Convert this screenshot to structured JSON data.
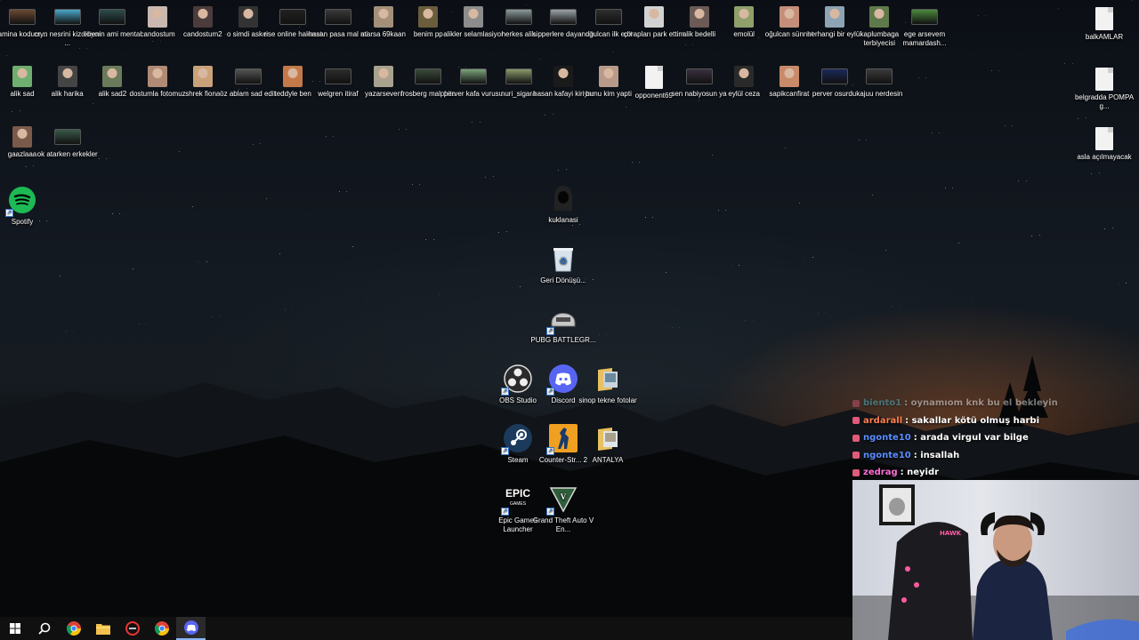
{
  "desktop": {
    "icons_row1": [
      {
        "label": "amina kodum...",
        "icon": "video-thumbnail",
        "color": "#6b4a32"
      },
      {
        "label": "cryn nesrini kizdiriyor ...",
        "icon": "video-thumbnail",
        "color": "#4aa7c9"
      },
      {
        "label": "ebenin ami mental",
        "icon": "video-thumbnail",
        "color": "#2f4c4c"
      },
      {
        "label": "candostum",
        "icon": "photo-thumbnail",
        "color": "#c9b7b0"
      },
      {
        "label": "candostum2",
        "icon": "photo-thumbnail",
        "color": "#4c3b3b"
      },
      {
        "label": "o simdi asker",
        "icon": "photo-thumbnail",
        "color": "#333333"
      },
      {
        "label": "rise online hakaret",
        "icon": "video-thumbnail",
        "color": "#222222"
      },
      {
        "label": "hasan pasa mal mi",
        "icon": "video-thumbnail",
        "color": "#3a3a3a"
      },
      {
        "label": "atarsa 69kaan",
        "icon": "photo-thumbnail",
        "color": "#a38f7a"
      },
      {
        "label": "benim pp",
        "icon": "photo-thumbnail",
        "color": "#6b5d3c"
      },
      {
        "label": "alikler selamlasiyor",
        "icon": "photo-thumbnail",
        "color": "#8c8c8c"
      },
      {
        "label": "herkes alik",
        "icon": "video-thumbnail",
        "color": "#8a9a9a"
      },
      {
        "label": "sipperlere dayandik",
        "icon": "video-thumbnail",
        "color": "#9aa3a8"
      },
      {
        "label": "ogulcan ilk edit",
        "icon": "video-thumbnail",
        "color": "#2e2e2e"
      },
      {
        "label": "çorapları park ettim",
        "icon": "photo-thumbnail",
        "color": "#d2d2d2"
      },
      {
        "label": "alik bedelli",
        "icon": "photo-thumbnail",
        "color": "#6b5a55"
      },
      {
        "label": "emolül",
        "icon": "photo-thumbnail",
        "color": "#8fa06b"
      },
      {
        "label": "oğulcan sünnet",
        "icon": "photo-thumbnail",
        "color": "#c48e7a"
      },
      {
        "label": "herhangi bir eylül",
        "icon": "photo-thumbnail",
        "color": "#8ea3b3"
      },
      {
        "label": "kaplumbaga terbiyecisi",
        "icon": "photo-thumbnail",
        "color": "#5f7a4a"
      },
      {
        "label": "ege arsevem mamardash...",
        "icon": "video-thumbnail",
        "color": "#4d8a3e"
      }
    ],
    "icons_row2": [
      {
        "label": "alik sad",
        "icon": "photo-thumbnail",
        "color": "#6fae6f"
      },
      {
        "label": "alik harika",
        "icon": "photo-thumbnail",
        "color": "#444444"
      },
      {
        "label": "alik sad2",
        "icon": "photo-thumbnail",
        "color": "#6b7a5a"
      },
      {
        "label": "dostumla fotomuz",
        "icon": "photo-thumbnail",
        "color": "#b08a74"
      },
      {
        "label": "shrek fiona",
        "icon": "photo-thumbnail",
        "color": "#c9a27a"
      },
      {
        "label": "öz ablam sad edit",
        "icon": "video-thumbnail",
        "color": "#555555"
      },
      {
        "label": "teddyle ben",
        "icon": "photo-thumbnail",
        "color": "#c47a48"
      },
      {
        "label": "welgren itiraf",
        "icon": "video-thumbnail",
        "color": "#2d2d2d"
      },
      {
        "label": "yazarseven",
        "icon": "photo-thumbnail",
        "color": "#a8a28e"
      },
      {
        "label": "frosberg malphite",
        "icon": "video-thumbnail",
        "color": "#3a4a3a"
      },
      {
        "label": "perver kafa vurusu",
        "icon": "video-thumbnail",
        "color": "#7aa37a"
      },
      {
        "label": "nuri_sigara",
        "icon": "video-thumbnail",
        "color": "#8a9a6a"
      },
      {
        "label": "hasan kafayi kiriyor",
        "icon": "photo-thumbnail",
        "color": "#1a1a1a"
      },
      {
        "label": "bunu kim yapti",
        "icon": "photo-thumbnail",
        "color": "#b89a8a"
      },
      {
        "label": "opponent69",
        "icon": "document-icon",
        "color": "#f2f2f2"
      },
      {
        "label": "sen nabiyosun ya",
        "icon": "video-thumbnail",
        "color": "#3a3040"
      },
      {
        "label": "eylül ceza",
        "icon": "photo-thumbnail",
        "color": "#2a2a2a"
      },
      {
        "label": "sapikcanfirat",
        "icon": "photo-thumbnail",
        "color": "#c98a6a"
      },
      {
        "label": "perver osurdu",
        "icon": "video-thumbnail",
        "color": "#1a2a5a"
      },
      {
        "label": "kajuu nerdesin",
        "icon": "video-thumbnail",
        "color": "#3a3a3a"
      }
    ],
    "icons_row3": [
      {
        "label": "gaazlaaa",
        "icon": "photo-thumbnail",
        "color": "#7a5a4a"
      },
      {
        "label": "ok atarken erkekler",
        "icon": "video-thumbnail",
        "color": "#3a5a4a"
      }
    ],
    "spotify": {
      "label": "Spotify",
      "icon": "spotify-icon",
      "color": "#1db954"
    },
    "right_column": [
      {
        "label": "balkAMLAR",
        "icon": "document-icon"
      },
      {
        "label": "belgradda POMPA g...",
        "icon": "document-icon"
      },
      {
        "label": "asla açılmayacak",
        "icon": "document-icon"
      }
    ],
    "center_icons": {
      "kuklanasi": {
        "label": "kuklanasi",
        "icon": "hooded-figure-icon"
      },
      "recycle": {
        "label": "Geri Dönüşü...",
        "icon": "recycle-bin-icon"
      },
      "pubg": {
        "label": "PUBG BATTLEGR...",
        "icon": "pubg-helmet-icon"
      },
      "obs": {
        "label": "OBS Studio",
        "icon": "obs-icon"
      },
      "discord": {
        "label": "Discord",
        "icon": "discord-icon",
        "color": "#5865f2"
      },
      "sinop": {
        "label": "sinop tekne fotolar",
        "icon": "folder-icon"
      },
      "steam": {
        "label": "Steam",
        "icon": "steam-icon"
      },
      "csgo": {
        "label": "Counter-Str... 2",
        "icon": "counter-strike-icon",
        "color": "#f0a020"
      },
      "antalya": {
        "label": "ANTALYA",
        "icon": "folder-icon"
      },
      "epic": {
        "label": "Epic Games Launcher",
        "icon": "epic-games-icon"
      },
      "gta": {
        "label": "Grand Theft Auto V En...",
        "icon": "gta-v-icon"
      }
    }
  },
  "chat": {
    "messages": [
      {
        "user": "biento1",
        "text": ": oynamıom knk bu el bekleyin",
        "user_color": "#4ec9e0",
        "faded": true
      },
      {
        "user": "ardarall",
        "text": ": sakallar kötü olmuş harbi",
        "user_color": "#ff7f50"
      },
      {
        "user": "ngonte10",
        "text": ": arada virgul var bilge",
        "user_color": "#5a8dff"
      },
      {
        "user": "ngonte10",
        "text": ": insallah",
        "user_color": "#5a8dff"
      },
      {
        "user": "zedrag",
        "text": ": neyidr",
        "user_color": "#ff6fd8"
      }
    ]
  },
  "webcam": {
    "chair_brand": "HAWK"
  },
  "taskbar": {
    "items": [
      {
        "name": "start-button",
        "icon": "windows-icon"
      },
      {
        "name": "search-button",
        "icon": "search-icon"
      },
      {
        "name": "chrome-button",
        "icon": "chrome-icon"
      },
      {
        "name": "file-explorer-button",
        "icon": "folder-icon"
      },
      {
        "name": "app-button",
        "icon": "red-circle-icon"
      },
      {
        "name": "chrome-button-2",
        "icon": "chrome-icon"
      },
      {
        "name": "discord-taskbar-button",
        "icon": "discord-icon"
      }
    ]
  }
}
